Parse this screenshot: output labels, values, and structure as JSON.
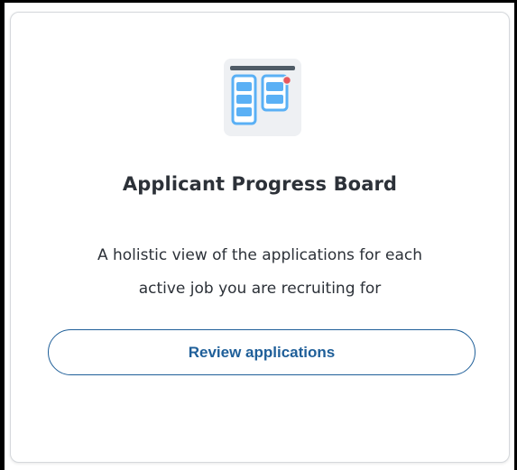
{
  "card": {
    "title": "Applicant Progress Board",
    "description_lines": [
      "A holistic view of the applications for each",
      "active job you are recruiting for"
    ],
    "button_label": "Review applications",
    "icon": "kanban-board-icon"
  },
  "colors": {
    "accent": "#1f5f99",
    "icon_blue": "#5ab0f5",
    "icon_dark": "#4f5b66",
    "notification_dot": "#e8585e",
    "title_text": "#2c3138"
  }
}
